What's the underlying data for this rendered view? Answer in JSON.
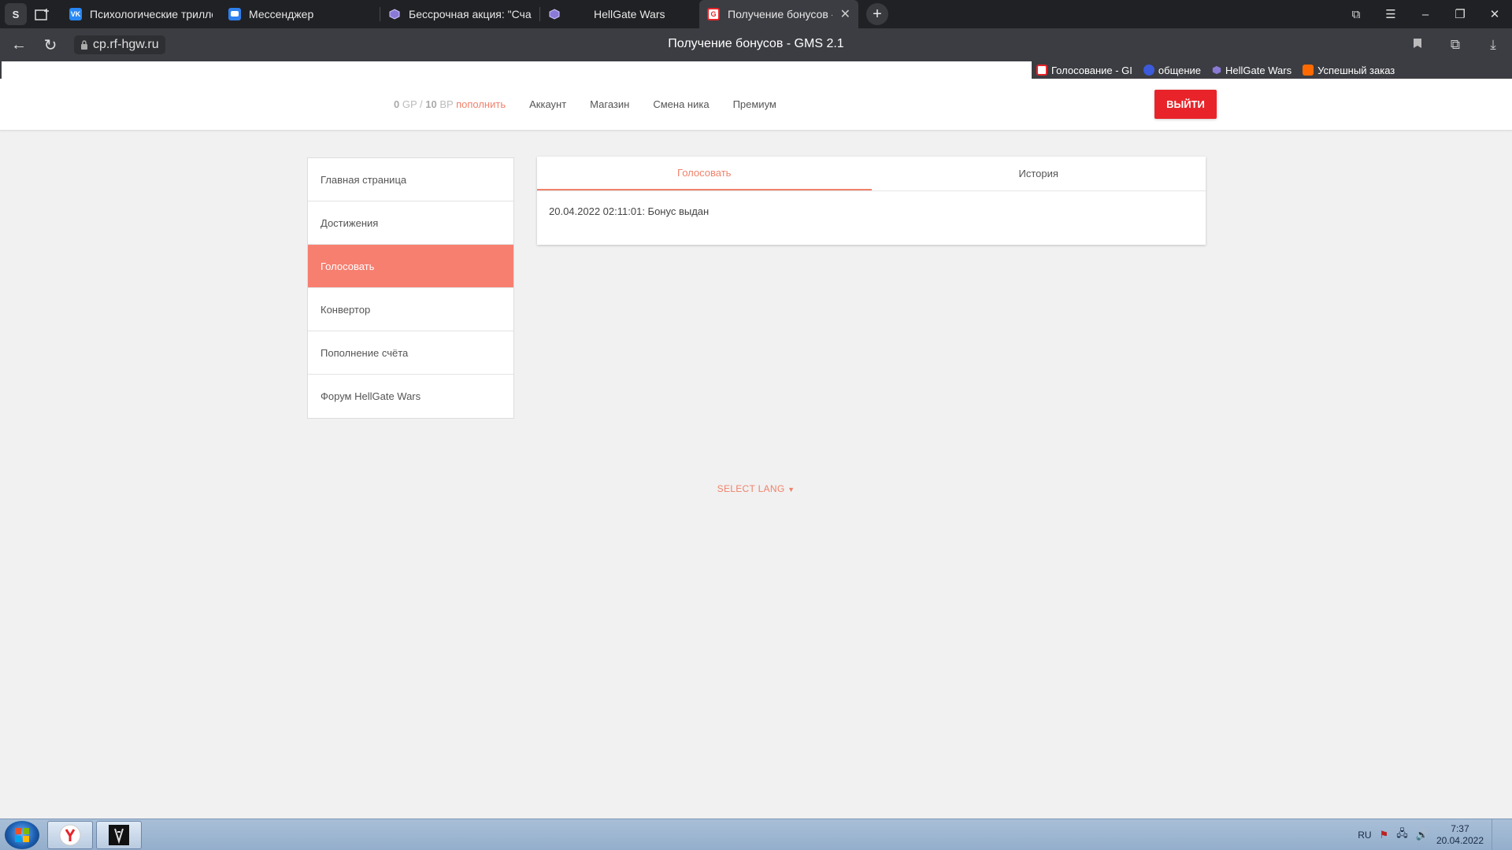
{
  "browser": {
    "tabs": [
      {
        "label": "Психологические триллер",
        "icon": "vk-icon"
      },
      {
        "label": "Мессенджер",
        "icon": "messenger-icon"
      },
      {
        "label": "Бессрочная акция: \"Счаст",
        "icon": "hellgate-icon"
      },
      {
        "label": "HellGate Wars",
        "icon": "hellgate-icon"
      },
      {
        "label": "Получение бонусов - G",
        "icon": "gms-icon"
      }
    ],
    "url": "cp.rf-hgw.ru",
    "page_title": "Получение бонусов - GMS 2.1",
    "bookmarks": [
      {
        "label": "Голосование - GI",
        "color": "#e8242a"
      },
      {
        "label": "общение",
        "color": "#3b5bdb"
      },
      {
        "label": "HellGate Wars",
        "color": "#8a6bd6"
      },
      {
        "label": "Успешный заказ",
        "color": "#ff6a00"
      }
    ]
  },
  "header": {
    "balance_gp_value": "0",
    "balance_gp_unit": "GP /",
    "balance_bp_value": "10",
    "balance_bp_unit": "BP",
    "topup_label": "пополнить",
    "nav": [
      "Аккаунт",
      "Магазин",
      "Смена ника",
      "Премиум"
    ],
    "logout_label": "ВЫЙТИ"
  },
  "sidebar": {
    "items": [
      {
        "label": "Главная страница"
      },
      {
        "label": "Достижения"
      },
      {
        "label": "Голосовать",
        "active": true
      },
      {
        "label": "Конвертор"
      },
      {
        "label": "Пополнение счёта"
      },
      {
        "label": "Форум HellGate Wars"
      }
    ]
  },
  "panel": {
    "tabs": [
      {
        "label": "Голосовать",
        "active": true
      },
      {
        "label": "История"
      }
    ],
    "log": "20.04.2022 02:11:01: Бонус выдан"
  },
  "footer": {
    "select_lang": "SELECT LANG"
  },
  "taskbar": {
    "lang": "RU",
    "time": "7:37",
    "date": "20.04.2022"
  },
  "colors": {
    "accent": "#f0826b",
    "sidebar_active": "#f77f70",
    "logout": "#e8242a"
  }
}
